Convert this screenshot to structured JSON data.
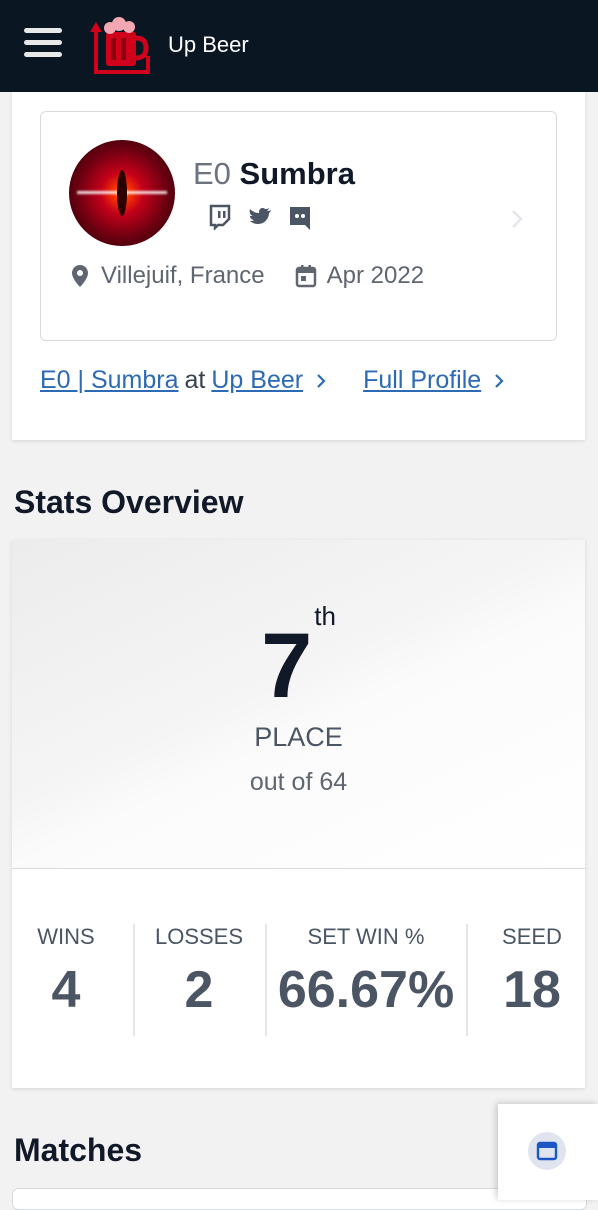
{
  "header": {
    "brand": "Up Beer"
  },
  "profile": {
    "prefix": "E0",
    "gamer_tag": "Sumbra",
    "location": "Villejuif, France",
    "joined": "Apr 2022",
    "socials": [
      "twitch-icon",
      "twitter-icon",
      "discord-icon"
    ],
    "team_link_name": "E0 | Sumbra",
    "team_link_at": "at",
    "team_link_org": "Up Beer",
    "full_profile_link": "Full Profile"
  },
  "stats_overview": {
    "title": "Stats Overview",
    "placement_number": "7",
    "placement_suffix": "th",
    "placement_label": "PLACE",
    "placement_total": "out of 64",
    "stats": [
      {
        "label": "WINS",
        "value": "4"
      },
      {
        "label": "LOSSES",
        "value": "2"
      },
      {
        "label": "SET WIN %",
        "value": "66.67%"
      },
      {
        "label": "SEED",
        "value": "18"
      }
    ]
  },
  "matches": {
    "title": "Matches"
  },
  "colors": {
    "topbar": "#0b1623",
    "link": "#2c6ab3",
    "brand_red": "#d0021b"
  }
}
